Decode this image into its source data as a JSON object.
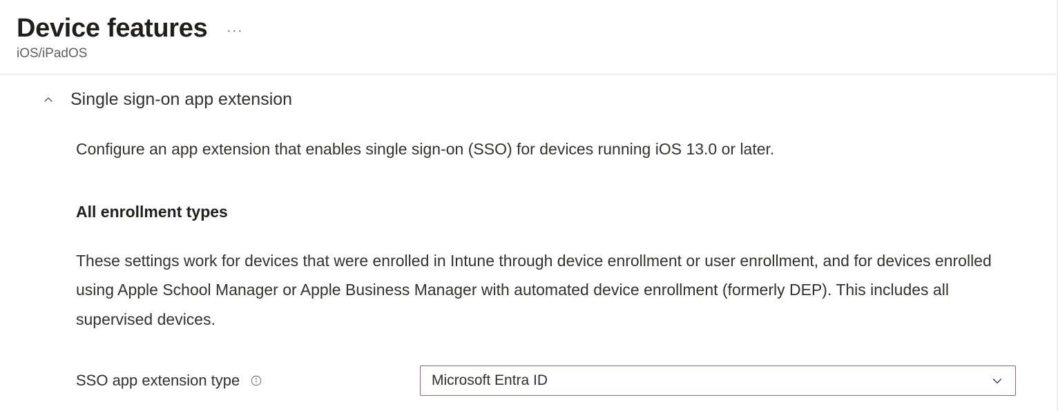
{
  "header": {
    "title": "Device features",
    "subtitle": "iOS/iPadOS"
  },
  "section": {
    "title": "Single sign-on app extension",
    "description": "Configure an app extension that enables single sign-on (SSO) for devices running iOS 13.0 or later.",
    "sub_heading": "All enrollment types",
    "sub_description": "These settings work for devices that were enrolled in Intune through device enrollment or user enrollment, and for devices enrolled using Apple School Manager or Apple Business Manager with automated device enrollment (formerly DEP). This includes all supervised devices."
  },
  "form": {
    "sso_type_label": "SSO app extension type",
    "sso_type_value": "Microsoft Entra ID"
  }
}
